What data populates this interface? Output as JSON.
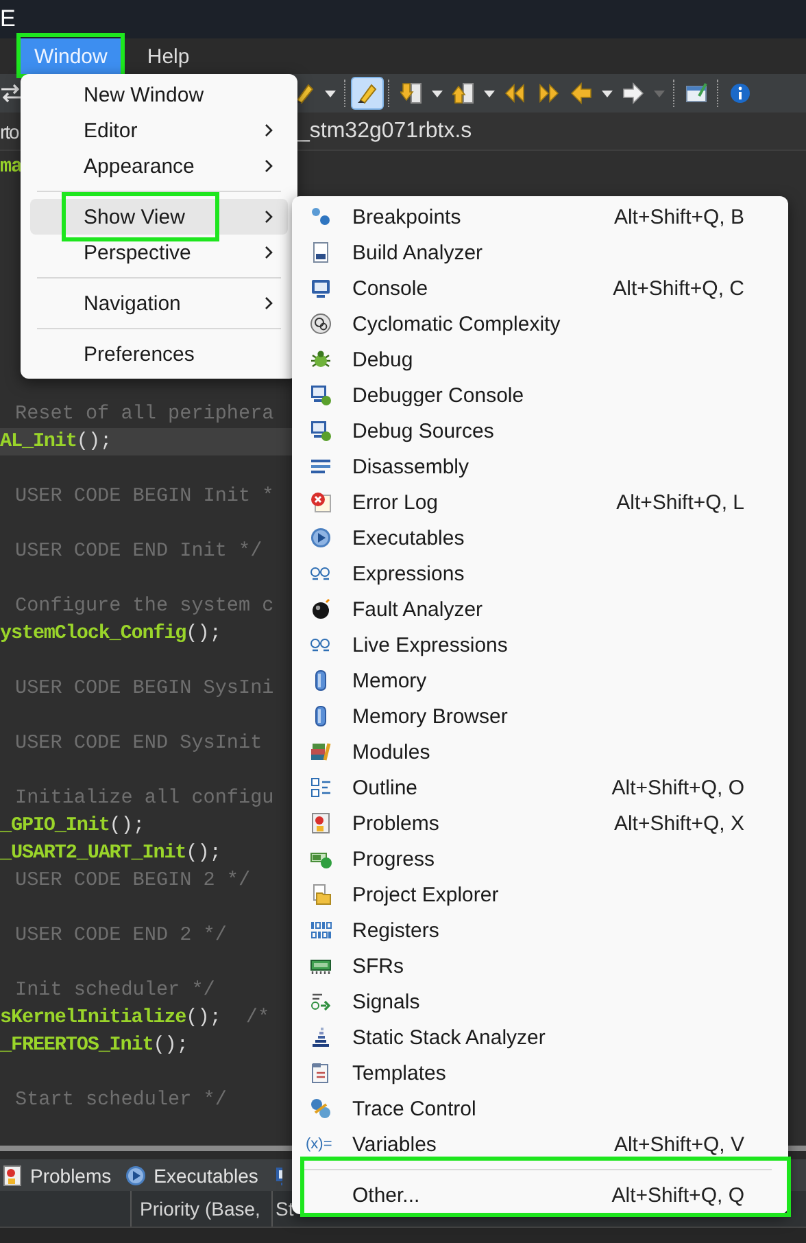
{
  "title_bar": {
    "title": "E"
  },
  "menu_bar": [
    {
      "label": "Window",
      "selected": true,
      "annotated": true
    },
    {
      "label": "Help",
      "selected": false,
      "annotated": false
    }
  ],
  "toolbar": [
    {
      "kind": "button",
      "pressed": false
    },
    {
      "kind": "dropdown",
      "disabled": false
    },
    {
      "kind": "separator"
    },
    {
      "kind": "button",
      "pressed": true
    },
    {
      "kind": "separator"
    },
    {
      "kind": "button",
      "pressed": false
    },
    {
      "kind": "dropdown",
      "disabled": false
    },
    {
      "kind": "button",
      "pressed": false
    },
    {
      "kind": "dropdown",
      "disabled": false
    },
    {
      "kind": "button",
      "pressed": false
    },
    {
      "kind": "button",
      "pressed": false
    },
    {
      "kind": "button",
      "pressed": false
    },
    {
      "kind": "dropdown",
      "disabled": false
    },
    {
      "kind": "button",
      "pressed": false
    },
    {
      "kind": "dropdown",
      "disabled": true
    },
    {
      "kind": "separator"
    },
    {
      "kind": "button",
      "pressed": false
    },
    {
      "kind": "separator"
    },
    {
      "kind": "button",
      "pressed": false
    }
  ],
  "editor_tabs": [
    {
      "label": "rto"
    },
    {
      "label": "_stm32g071rbtx.s"
    }
  ],
  "code_lines": [
    {
      "kind": "call",
      "name": "ma",
      "current": false
    },
    {
      "kind": "comment",
      "text": "Reset of all periphera",
      "current": false
    },
    {
      "kind": "call",
      "name": "AL_Init",
      "rest": "();",
      "current": true
    },
    {
      "kind": "comment",
      "text": "USER CODE BEGIN Init *",
      "current": false
    },
    {
      "kind": "comment",
      "text": "USER CODE END Init */",
      "current": false
    },
    {
      "kind": "comment",
      "text": "Configure the system c",
      "current": false
    },
    {
      "kind": "call",
      "name": "ystemClock_Config",
      "rest": "();",
      "current": false
    },
    {
      "kind": "comment",
      "text": "USER CODE BEGIN SysIni",
      "current": false
    },
    {
      "kind": "comment",
      "text": "USER CODE END SysInit",
      "current": false
    },
    {
      "kind": "comment",
      "text": "Initialize all configu",
      "current": false
    },
    {
      "kind": "call",
      "name": "_GPIO_Init",
      "rest": "();",
      "current": false
    },
    {
      "kind": "call",
      "name": "_USART2_UART_Init",
      "rest": "();",
      "current": false
    },
    {
      "kind": "comment",
      "text": "USER CODE BEGIN 2 */",
      "current": false
    },
    {
      "kind": "comment",
      "text": "USER CODE END 2 */",
      "current": false
    },
    {
      "kind": "comment",
      "text": "Init scheduler */",
      "current": false
    },
    {
      "kind": "call",
      "name": "sKernelInitialize",
      "rest": "();",
      "trailing_comment": "/*",
      "current": false
    },
    {
      "kind": "call",
      "name": "_FREERTOS_Init",
      "rest": "();",
      "current": false
    },
    {
      "kind": "comment",
      "text": "Start scheduler */",
      "current": false
    }
  ],
  "bottom_panel": {
    "tabs": [
      {
        "label": "Problems"
      },
      {
        "label": "Executables"
      }
    ],
    "columns": [
      {
        "label": "Priority (Base,"
      },
      {
        "label": "St"
      }
    ]
  },
  "window_menu": {
    "items": [
      {
        "kind": "item",
        "label": "New Window",
        "submenu": false,
        "selected": false,
        "annotated": false
      },
      {
        "kind": "item",
        "label": "Editor",
        "submenu": true,
        "selected": false,
        "annotated": false
      },
      {
        "kind": "item",
        "label": "Appearance",
        "submenu": true,
        "selected": false,
        "annotated": false
      },
      {
        "kind": "separator"
      },
      {
        "kind": "item",
        "label": "Show View",
        "submenu": true,
        "selected": true,
        "annotated": true
      },
      {
        "kind": "item",
        "label": "Perspective",
        "submenu": true,
        "selected": false,
        "annotated": false
      },
      {
        "kind": "separator"
      },
      {
        "kind": "item",
        "label": "Navigation",
        "submenu": true,
        "selected": false,
        "annotated": false
      },
      {
        "kind": "separator"
      },
      {
        "kind": "item",
        "label": "Preferences",
        "submenu": false,
        "selected": false,
        "annotated": false
      }
    ]
  },
  "show_view_menu": {
    "items": [
      {
        "kind": "item",
        "label": "Breakpoints",
        "shortcut": "Alt+Shift+Q, B",
        "annotated": false
      },
      {
        "kind": "item",
        "label": "Build Analyzer",
        "annotated": false
      },
      {
        "kind": "item",
        "label": "Console",
        "shortcut": "Alt+Shift+Q, C",
        "annotated": false
      },
      {
        "kind": "item",
        "label": "Cyclomatic Complexity",
        "annotated": false
      },
      {
        "kind": "item",
        "label": "Debug",
        "annotated": false
      },
      {
        "kind": "item",
        "label": "Debugger Console",
        "annotated": false
      },
      {
        "kind": "item",
        "label": "Debug Sources",
        "annotated": false
      },
      {
        "kind": "item",
        "label": "Disassembly",
        "annotated": false
      },
      {
        "kind": "item",
        "label": "Error Log",
        "shortcut": "Alt+Shift+Q, L",
        "annotated": false
      },
      {
        "kind": "item",
        "label": "Executables",
        "annotated": false
      },
      {
        "kind": "item",
        "label": "Expressions",
        "annotated": false
      },
      {
        "kind": "item",
        "label": "Fault Analyzer",
        "annotated": false
      },
      {
        "kind": "item",
        "label": "Live Expressions",
        "annotated": false
      },
      {
        "kind": "item",
        "label": "Memory",
        "annotated": false
      },
      {
        "kind": "item",
        "label": "Memory Browser",
        "annotated": false
      },
      {
        "kind": "item",
        "label": "Modules",
        "annotated": false
      },
      {
        "kind": "item",
        "label": "Outline",
        "shortcut": "Alt+Shift+Q, O",
        "annotated": false
      },
      {
        "kind": "item",
        "label": "Problems",
        "shortcut": "Alt+Shift+Q, X",
        "annotated": false
      },
      {
        "kind": "item",
        "label": "Progress",
        "annotated": false
      },
      {
        "kind": "item",
        "label": "Project Explorer",
        "annotated": false
      },
      {
        "kind": "item",
        "label": "Registers",
        "annotated": false
      },
      {
        "kind": "item",
        "label": "SFRs",
        "annotated": false
      },
      {
        "kind": "item",
        "label": "Signals",
        "annotated": false
      },
      {
        "kind": "item",
        "label": "Static Stack Analyzer",
        "annotated": false
      },
      {
        "kind": "item",
        "label": "Templates",
        "annotated": false
      },
      {
        "kind": "item",
        "label": "Trace Control",
        "annotated": false
      },
      {
        "kind": "item",
        "label": "Variables",
        "glyph": "(x)=",
        "shortcut": "Alt+Shift+Q, V",
        "annotated": false
      },
      {
        "kind": "separator"
      },
      {
        "kind": "item",
        "label": "Other...",
        "shortcut": "Alt+Shift+Q, Q",
        "annotated": true
      }
    ]
  }
}
